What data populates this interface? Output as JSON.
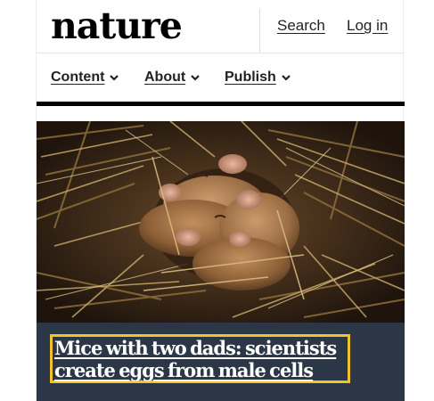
{
  "brand": {
    "logo_text": "nature"
  },
  "header": {
    "search_label": "Search",
    "login_label": "Log in"
  },
  "nav": {
    "items": [
      {
        "label": "Content"
      },
      {
        "label": "About"
      },
      {
        "label": "Publish"
      }
    ]
  },
  "hero": {
    "image_subject": "mice-in-nest",
    "headline_line1": "Mice with two dads: scientists",
    "headline_line2": "create eggs from male cells"
  },
  "colors": {
    "caption_bg": "#2b3746",
    "focus_outline": "#f2c12e",
    "rule": "#000000"
  }
}
